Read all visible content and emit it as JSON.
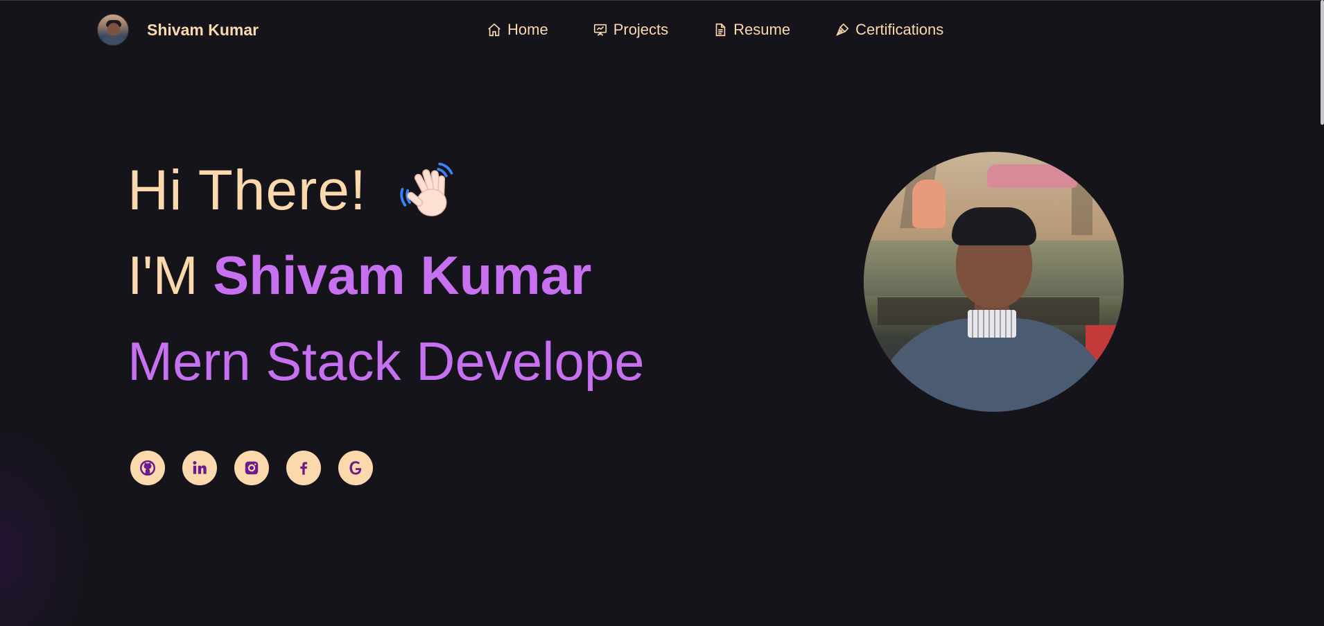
{
  "brand": {
    "name": "Shivam Kumar"
  },
  "nav": {
    "items": [
      {
        "label": "Home",
        "icon": "home-icon"
      },
      {
        "label": "Projects",
        "icon": "presentation-icon"
      },
      {
        "label": "Resume",
        "icon": "document-icon"
      },
      {
        "label": "Certifications",
        "icon": "pen-nib-icon"
      }
    ]
  },
  "hero": {
    "greeting": "Hi There!",
    "intro_prefix": "I'M",
    "intro_name": "Shivam Kumar",
    "role": "Mern Stack Develope"
  },
  "socials": [
    {
      "icon": "github-icon"
    },
    {
      "icon": "linkedin-icon"
    },
    {
      "icon": "instagram-icon"
    },
    {
      "icon": "facebook-icon"
    },
    {
      "icon": "google-icon"
    }
  ],
  "colors": {
    "background": "#15141b",
    "accent_cream": "#fbd9ad",
    "accent_purple": "#c770f0",
    "icon_purple": "#6d1b8a"
  }
}
